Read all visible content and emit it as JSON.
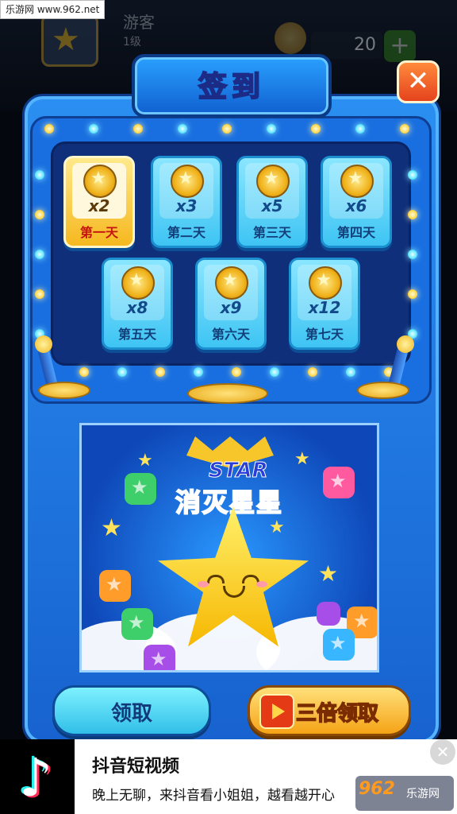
{
  "site_watermark": "乐游网 www.962.net",
  "hud": {
    "player_name": "游客",
    "player_level": "1级",
    "coins": "20",
    "plus": "+"
  },
  "dialog": {
    "title": "签到",
    "close": "✕"
  },
  "days": [
    {
      "multiplier": "x2",
      "label": "第一天",
      "active": true
    },
    {
      "multiplier": "x3",
      "label": "第二天",
      "active": false
    },
    {
      "multiplier": "x5",
      "label": "第三天",
      "active": false
    },
    {
      "multiplier": "x6",
      "label": "第四天",
      "active": false
    },
    {
      "multiplier": "x8",
      "label": "第五天",
      "active": false
    },
    {
      "multiplier": "x9",
      "label": "第六天",
      "active": false
    },
    {
      "multiplier": "x12",
      "label": "第七天",
      "active": false
    }
  ],
  "banner": {
    "logo_word": "STAR",
    "logo_cn": "消灭星星"
  },
  "buttons": {
    "claim": "领取",
    "triple_claim": "三倍领取"
  },
  "ad": {
    "app_name": "抖音短视频",
    "description": "晚上无聊，来抖音看小姐姐，越看越开心",
    "close": "✕"
  },
  "bottom_watermark": {
    "number": "962",
    "text": "乐游网"
  },
  "colors": {
    "panel_blue": "#1f7ae8",
    "tile_cyan": "#3ec4f3",
    "tile_gold": "#f6b81f",
    "close_orange": "#e5431d"
  }
}
